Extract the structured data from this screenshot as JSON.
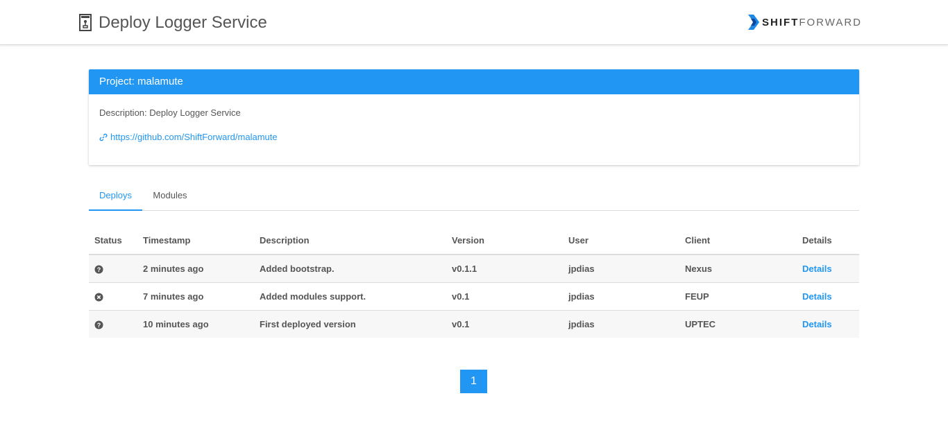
{
  "header": {
    "title": "Deploy Logger Service",
    "logo": {
      "part1": "SHIFT",
      "part2": "FORWARD"
    },
    "icon": "document-icon"
  },
  "project": {
    "title": "Project: malamute",
    "description": "Description: Deploy Logger Service",
    "link": "https://github.com/ShiftForward/malamute",
    "link_icon": "link-icon"
  },
  "tabs": [
    {
      "label": "Deploys",
      "active": true
    },
    {
      "label": "Modules",
      "active": false
    }
  ],
  "table": {
    "headers": [
      "Status",
      "Timestamp",
      "Description",
      "Version",
      "User",
      "Client",
      "Details"
    ],
    "rows": [
      {
        "status": "question-circle-icon",
        "timestamp": "2 minutes ago",
        "description": "Added bootstrap.",
        "version": "v0.1.1",
        "user": "jpdias",
        "client": "Nexus",
        "details": "Details"
      },
      {
        "status": "times-circle-icon",
        "timestamp": "7 minutes ago",
        "description": "Added modules support.",
        "version": "v0.1",
        "user": "jpdias",
        "client": "FEUP",
        "details": "Details"
      },
      {
        "status": "question-circle-icon",
        "timestamp": "10 minutes ago",
        "description": "First deployed version",
        "version": "v0.1",
        "user": "jpdias",
        "client": "UPTEC",
        "details": "Details"
      }
    ]
  },
  "pagination": {
    "current": "1"
  },
  "colors": {
    "accent": "#2196f3",
    "text": "#555555",
    "row_stripe": "#f7f7f7"
  }
}
